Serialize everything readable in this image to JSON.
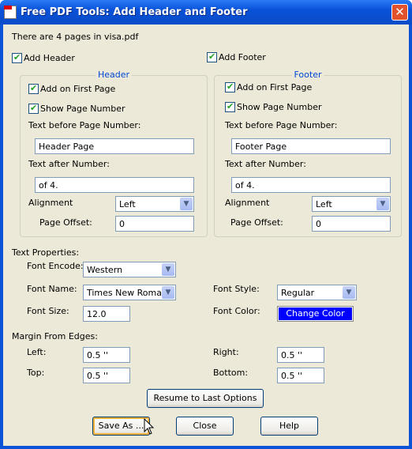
{
  "window": {
    "title": "Free PDF Tools: Add Header and Footer",
    "close": "✕"
  },
  "info": "There are 4 pages in visa.pdf",
  "add_header": {
    "label": "Add Header",
    "checked": true
  },
  "add_footer": {
    "label": "Add Footer",
    "checked": true
  },
  "header": {
    "legend": "Header",
    "first_page": "Add on First Page",
    "show_number": "Show Page Number",
    "before_label": "Text before Page Number:",
    "before_value": "Header Page",
    "after_label": "Text after Number:",
    "after_value": "of 4.",
    "align_label": "Alignment",
    "align_value": "Left",
    "offset_label": "Page Offset:",
    "offset_value": "0"
  },
  "footer": {
    "legend": "Footer",
    "first_page": "Add on First Page",
    "show_number": "Show Page Number",
    "before_label": "Text before Page Number:",
    "before_value": "Footer Page",
    "after_label": "Text after Number:",
    "after_value": "of 4.",
    "align_label": "Alignment",
    "align_value": "Left",
    "offset_label": "Page Offset:",
    "offset_value": "0"
  },
  "text_props": {
    "title": "Text Properties:",
    "encode_label": "Font Encode:",
    "encode_value": "Western",
    "name_label": "Font Name:",
    "name_value": "Times New Roman",
    "style_label": "Font Style:",
    "style_value": "Regular",
    "size_label": "Font Size:",
    "size_value": "12.0",
    "color_label": "Font Color:",
    "color_button": "Change Color",
    "color_value": "#0000FF"
  },
  "margins": {
    "title": "Margin From Edges:",
    "left_label": "Left:",
    "left": "0.5 ''",
    "right_label": "Right:",
    "right": "0.5 ''",
    "top_label": "Top:",
    "top": "0.5 ''",
    "bottom_label": "Bottom:",
    "bottom": "0.5 ''"
  },
  "buttons": {
    "resume": "Resume to Last Options",
    "save": "Save As ...",
    "close": "Close",
    "help": "Help"
  }
}
